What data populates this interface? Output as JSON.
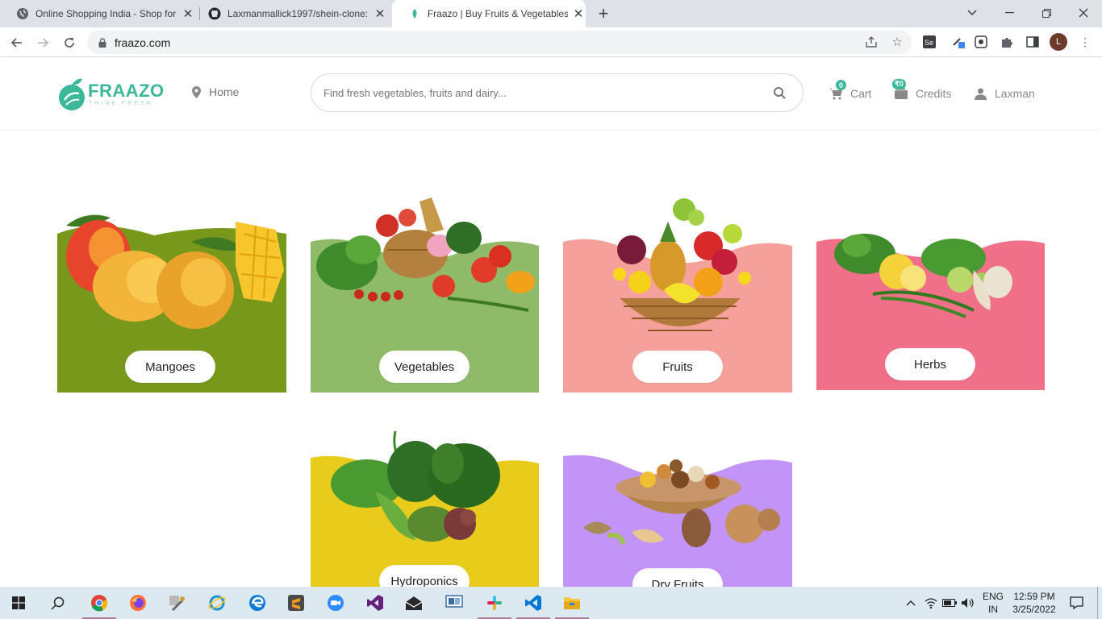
{
  "browser": {
    "tabs": [
      {
        "title": "Online Shopping India - Shop for",
        "icon": "globe-icon"
      },
      {
        "title": "Laxmanmallick1997/shein-clone:",
        "icon": "github-icon"
      },
      {
        "title": "Fraazo | Buy Fruits & Vegetables",
        "icon": "fraazo-leaf-icon",
        "active": true
      }
    ],
    "url": "fraazo.com",
    "profile_initial": "L"
  },
  "header": {
    "brand": "FRAAZO",
    "tagline": "THINK FRESH",
    "home_label": "Home",
    "search_placeholder": "Find fresh vegetables, fruits and dairy...",
    "cart_label": "Cart",
    "cart_count": "0",
    "credits_label": "Credits",
    "credits_badge": "₹0",
    "user_label": "Laxman",
    "accent_color": "#3bb89a"
  },
  "categories": [
    {
      "label": "Mangoes",
      "color": "#78981b"
    },
    {
      "label": "Vegetables",
      "color": "#8fbb68"
    },
    {
      "label": "Fruits",
      "color": "#f6a09b"
    },
    {
      "label": "Herbs",
      "color": "#ef7088"
    },
    {
      "label": "Hydroponics",
      "color": "#e8cb1b"
    },
    {
      "label": "Dry Fruits",
      "color": "#c394f7"
    }
  ],
  "taskbar": {
    "apps": [
      "windows-start",
      "search",
      "chrome",
      "firefox",
      "tools",
      "internet-explorer",
      "edge",
      "sublime-text",
      "zoom",
      "visual-studio",
      "mail-app",
      "remote-desktop",
      "slack",
      "vscode",
      "file-explorer"
    ],
    "language_top": "ENG",
    "language_bottom": "IN",
    "time": "12:59 PM",
    "date": "3/25/2022"
  }
}
